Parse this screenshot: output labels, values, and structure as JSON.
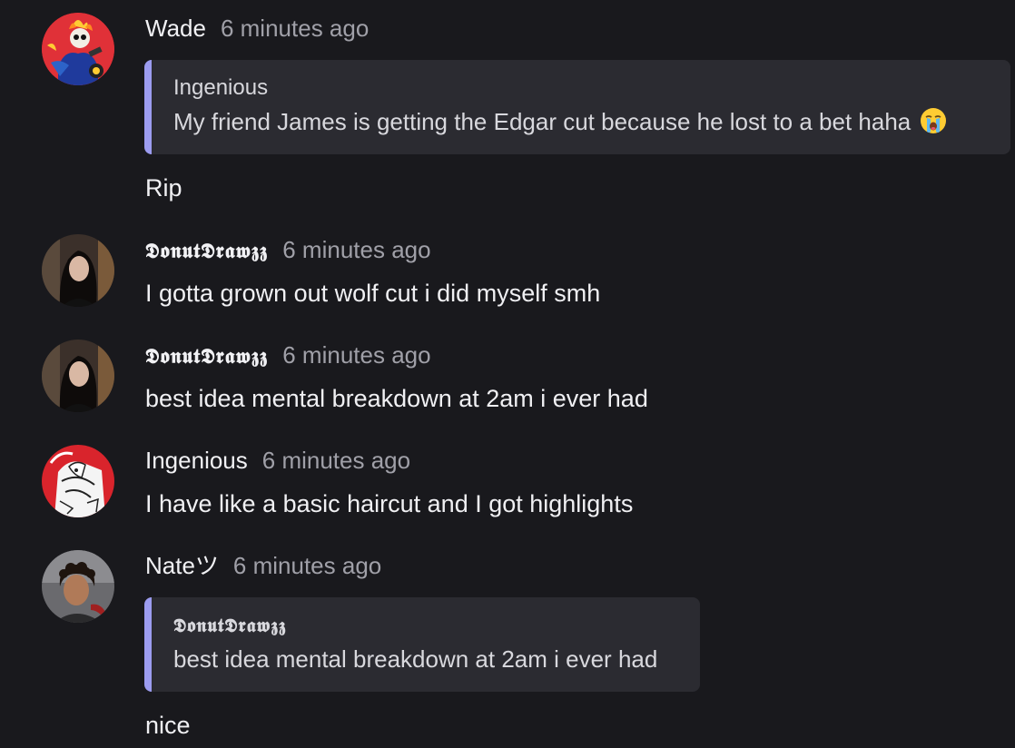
{
  "messages": [
    {
      "author": "Wade",
      "time": "6 minutes ago",
      "avatar": "ghost-rider-avatar",
      "quote": {
        "author": "Ingenious",
        "text": "My friend James is getting the Edgar cut because he lost to a bet haha",
        "emoji": "loudly-crying-face-icon"
      },
      "text": "Rip"
    },
    {
      "author": "𝕯𝖔𝖓𝖚𝖙𝕯𝖗𝖆𝖜𝖟𝖟",
      "time": "6 minutes ago",
      "avatar": "dark-hair-girl-avatar",
      "text": "I gotta grown out wolf cut i did myself smh"
    },
    {
      "author": "𝕯𝖔𝖓𝖚𝖙𝕯𝖗𝖆𝖜𝖟𝖟",
      "time": "6 minutes ago",
      "avatar": "dark-hair-girl-avatar",
      "text": "best idea mental breakdown at 2am i ever had"
    },
    {
      "author": "Ingenious",
      "time": "6 minutes ago",
      "avatar": "sketch-art-avatar",
      "text": "I have like a basic haircut and I got highlights"
    },
    {
      "author": "Nateツ",
      "time": "6 minutes ago",
      "avatar": "curly-hair-boy-avatar",
      "quote": {
        "author": "𝕯𝖔𝖓𝖚𝖙𝕯𝖗𝖆𝖜𝖟𝖟",
        "text": "best idea mental breakdown at 2am i ever had"
      },
      "text": "nice"
    }
  ],
  "colors": {
    "background": "#19191d",
    "quote_background": "#2b2b31",
    "quote_accent": "#9c9cf0",
    "timestamp": "#a0a0a8"
  }
}
